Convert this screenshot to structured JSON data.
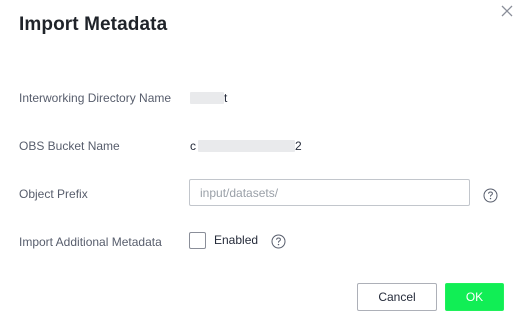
{
  "dialog": {
    "title": "Import Metadata",
    "close_icon": "close-icon"
  },
  "fields": {
    "directory": {
      "label": "Interworking Directory Name",
      "value_prefix": "",
      "value_suffix": "t"
    },
    "bucket": {
      "label": "OBS Bucket Name",
      "value_prefix": "c",
      "value_suffix": "2"
    },
    "prefix": {
      "label": "Object Prefix",
      "placeholder": "input/datasets/",
      "value": "",
      "help_icon": "help-icon"
    },
    "additional": {
      "label": "Import Additional Metadata",
      "checkbox_label": "Enabled",
      "checked": false,
      "help_icon": "help-icon"
    }
  },
  "buttons": {
    "cancel": "Cancel",
    "ok": "OK"
  },
  "colors": {
    "ok_button": "#11ee55",
    "text_primary": "#252b3a",
    "text_label": "#575d6c",
    "border": "#c2c6cc"
  }
}
